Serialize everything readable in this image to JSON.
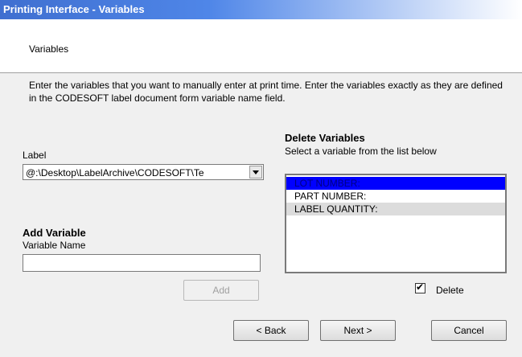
{
  "window": {
    "title": "Printing Interface - Variables"
  },
  "header": {
    "text": "Variables"
  },
  "instructions": "Enter the variables that you want to manually enter at print time. Enter the variables exactly as they are defined in the CODESOFT label document form variable name field.",
  "label_section": {
    "label": "Label",
    "combo_value": "@:\\Desktop\\LabelArchive\\CODESOFT\\Te"
  },
  "add_section": {
    "heading": "Add Variable",
    "field_label": "Variable Name",
    "field_value": "",
    "add_button": "Add"
  },
  "delete_section": {
    "heading": "Delete Variables",
    "subtitle": "Select a variable from the list below",
    "items": [
      "LOT NUMBER:",
      "PART NUMBER:",
      "LABEL QUANTITY:"
    ],
    "checkbox_label": "Delete",
    "checkbox_checked": true
  },
  "footer": {
    "back": "< Back",
    "next": "Next >",
    "cancel": "Cancel"
  }
}
